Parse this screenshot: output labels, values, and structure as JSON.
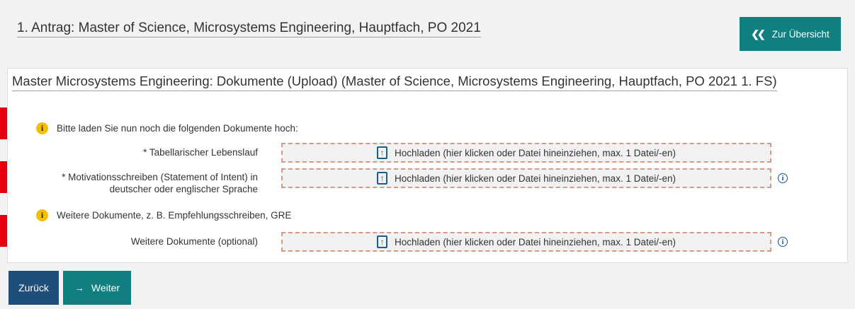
{
  "header": {
    "application_title": "1. Antrag: Master of Science, Microsystems Engineering, Hauptfach, PO 2021",
    "overview_button": "Zur Übersicht",
    "overview_icon": "double-chevron-left-icon"
  },
  "panel": {
    "heading": "Master Microsystems Engineering: Dokumente (Upload) (Master of Science, Microsystems Engineering, Hauptfach, PO 2021 1. FS)",
    "info_required": "Bitte laden Sie nun noch die folgenden Dokumente hoch:",
    "info_optional": "Weitere Dokumente, z. B. Empfehlungsschreiben, GRE",
    "info_icon_glyph": "i",
    "help_icon_glyph": "i",
    "upload_icon_glyph": "↑",
    "fields": [
      {
        "label": "* Tabellarischer Lebenslauf",
        "upload_text": "Hochladen (hier klicken oder Datei hineinziehen, max. 1 Datei/-en)"
      },
      {
        "label_line1": "* Motivationsschreiben (Statement of Intent) in",
        "label_line2": "deutscher oder englischer Sprache",
        "upload_text": "Hochladen (hier klicken oder Datei hineinziehen, max. 1 Datei/-en)"
      },
      {
        "label": "Weitere Dokumente (optional)",
        "upload_text": "Hochladen (hier klicken oder Datei hineinziehen, max. 1 Datei/-en)"
      }
    ]
  },
  "footer": {
    "back_button": "Zurück",
    "next_button": "Weiter",
    "next_icon": "arrow-right-icon"
  },
  "colors": {
    "teal": "#0f7f7f",
    "navy": "#1e4e79",
    "marker_red": "#e8000f",
    "info_yellow": "#f3c000",
    "dropzone_border": "#d49a86"
  }
}
